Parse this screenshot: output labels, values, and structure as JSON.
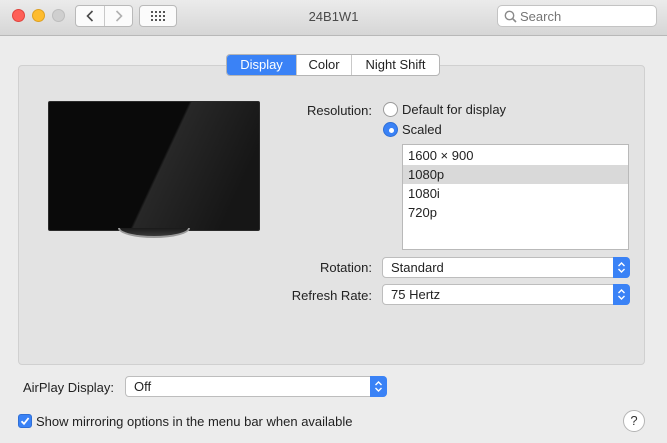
{
  "window": {
    "title": "24B1W1"
  },
  "toolbar": {
    "search_placeholder": "Search"
  },
  "tabs": [
    {
      "label": "Display",
      "active": true
    },
    {
      "label": "Color",
      "active": false
    },
    {
      "label": "Night Shift",
      "active": false
    }
  ],
  "resolution": {
    "label": "Resolution:",
    "options": [
      {
        "label": "Default for display",
        "selected": false
      },
      {
        "label": "Scaled",
        "selected": true
      }
    ],
    "list": [
      "1600 × 900",
      "1080p",
      "1080i",
      "720p"
    ],
    "list_selected": "1080p"
  },
  "rotation": {
    "label": "Rotation:",
    "value": "Standard"
  },
  "refresh_rate": {
    "label": "Refresh Rate:",
    "value": "75 Hertz"
  },
  "airplay": {
    "label": "AirPlay Display:",
    "value": "Off"
  },
  "mirroring": {
    "label": "Show mirroring options in the menu bar when available",
    "checked": true
  },
  "help": {
    "label": "?"
  },
  "colors": {
    "accent": "#3a82f6",
    "close": "#fe5f57",
    "minimize": "#febc2e"
  },
  "icons": [
    "back-icon",
    "forward-icon",
    "grid-icon",
    "search-icon",
    "checkmark-icon",
    "stepper-icon"
  ]
}
